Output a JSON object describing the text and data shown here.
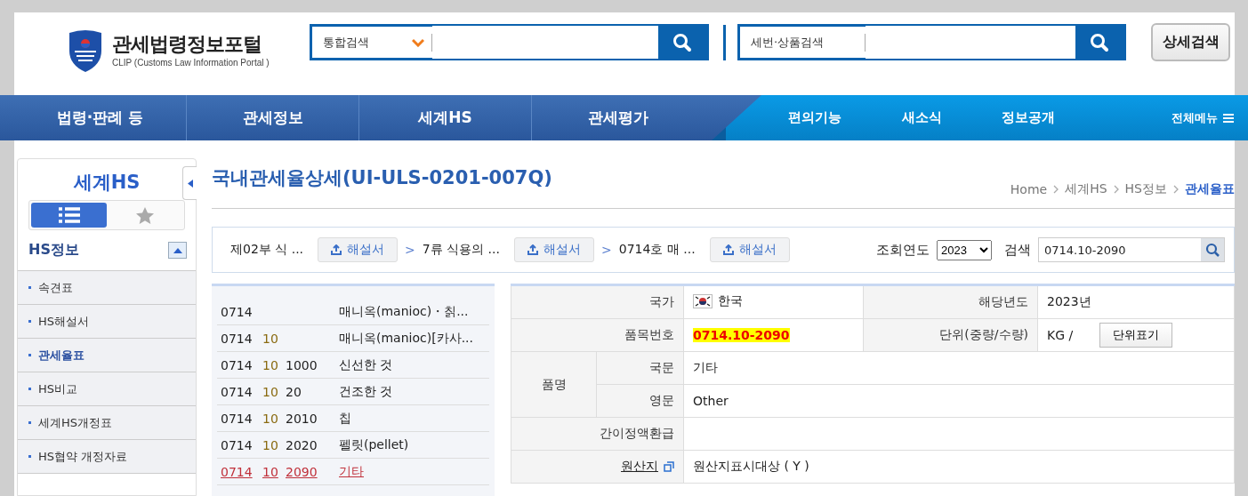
{
  "header": {
    "title": "관세법령정보포털",
    "subtitle": "CLIP (Customs Law Information Portal )",
    "search_main": {
      "scope": "통합검색"
    },
    "search_code": {
      "label": "세번·상품검색"
    },
    "detail_button": "상세검색"
  },
  "nav": {
    "main": [
      "법령·판례 등",
      "관세정보",
      "세계HS",
      "관세평가"
    ],
    "sub": [
      "편의기능",
      "새소식",
      "정보공개"
    ],
    "all_menu": "전체메뉴"
  },
  "sidebar": {
    "title": "세계HS",
    "views": [
      {
        "kind": "list",
        "selected": true
      },
      {
        "kind": "star",
        "selected": false
      }
    ],
    "section": {
      "title": "HS정보",
      "expanded": true
    },
    "items": [
      {
        "label": "속견표",
        "selected": false
      },
      {
        "label": "HS해설서",
        "selected": false
      },
      {
        "label": "관세율표",
        "selected": true
      },
      {
        "label": "HS비교",
        "selected": false
      },
      {
        "label": "세계HS개정표",
        "selected": false
      },
      {
        "label": "HS협약 개정자료",
        "selected": false
      }
    ]
  },
  "page": {
    "title": "국내관세율상세(UI-ULS-0201-007Q)",
    "breadcrumb": [
      "Home",
      "세계HS",
      "HS정보",
      "관세율표"
    ]
  },
  "path": [
    {
      "label": "제02부 식 ...",
      "button": "해설서"
    },
    {
      "separator": ">",
      "label": "7류 식용의 ...",
      "button": "해설서"
    },
    {
      "separator": ">",
      "label": "0714호 매 ...",
      "button": "해설서"
    }
  ],
  "year": {
    "label": "조회연도",
    "value": "2023"
  },
  "search": {
    "label": "검색",
    "value": "0714.10-2090"
  },
  "codes": [
    {
      "heading": "0714",
      "name": "매니옥(manioc)・칡...",
      "selected": false
    },
    {
      "heading": "0714",
      "sub": "10",
      "name": "매니옥(manioc)[카사...",
      "selected": false
    },
    {
      "heading": "0714",
      "sub": "10",
      "code": "1000",
      "name": "신선한 것",
      "selected": false
    },
    {
      "heading": "0714",
      "sub": "10",
      "code": "20",
      "name": "건조한 것",
      "selected": false
    },
    {
      "heading": "0714",
      "sub": "10",
      "code": "2010",
      "name": "칩",
      "selected": false
    },
    {
      "heading": "0714",
      "sub": "10",
      "code": "2020",
      "name": "펠릿(pellet)",
      "selected": false
    },
    {
      "heading": "0714",
      "sub": "10",
      "code": "2090",
      "name": "기타",
      "selected": true
    }
  ],
  "detail": {
    "country_label": "국가",
    "country": "한국",
    "year_label": "해당년도",
    "year": "2023년",
    "code_label": "품목번호",
    "code": "0714.10-2090",
    "unit_label": "단위(중량/수량)",
    "unit": "KG /",
    "unit_button": "단위표기",
    "name_label": "품명",
    "korean_label": "국문",
    "korean": "기타",
    "english_label": "영문",
    "english": "Other",
    "refund_label": "간이정액환급",
    "origin_label": "원산지",
    "origin": "원산지표시대상 ( Y )"
  }
}
